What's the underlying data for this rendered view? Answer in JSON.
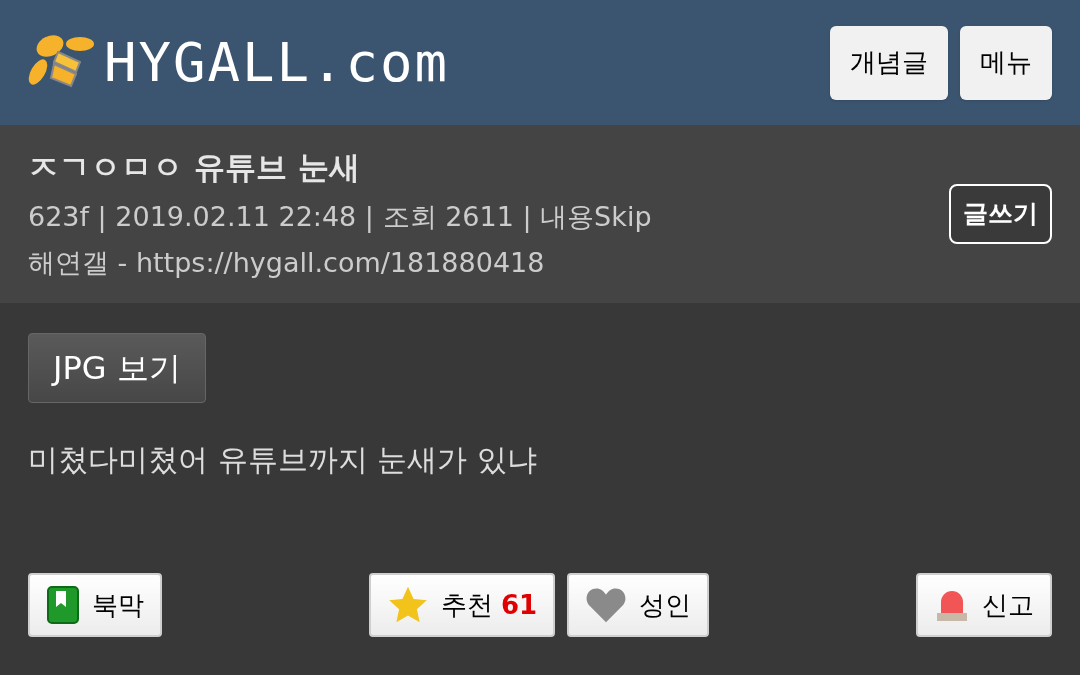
{
  "header": {
    "logo": "HYGALL.com",
    "buttons": [
      "개념글",
      "메뉴"
    ]
  },
  "post": {
    "title": "ㅈㄱㅇㅁㅇ 유튜브 눈새",
    "meta": "623f | 2019.02.11 22:48 | 조회 2611 | 내용Skip",
    "source": "해연갤 - https://hygall.com/181880418",
    "write_button": "글쓰기"
  },
  "body": {
    "jpg_button": "JPG 보기",
    "text": "미쳤다미쳤어 유튜브까지 눈새가 있냐"
  },
  "actions": [
    {
      "kind": "bookmark",
      "label": "북막"
    },
    {
      "kind": "recommend",
      "label": "추천",
      "count": "61"
    },
    {
      "kind": "adult",
      "label": "성인"
    },
    {
      "kind": "report",
      "label": "신고"
    }
  ]
}
